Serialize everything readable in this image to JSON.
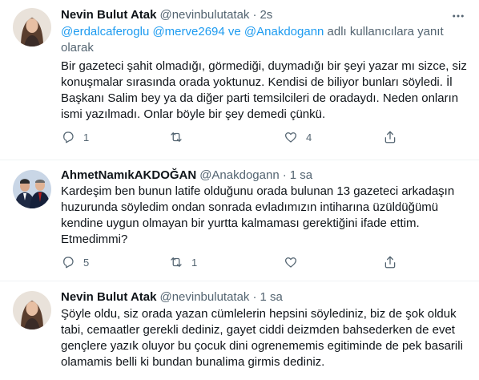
{
  "tweets": [
    {
      "author_name": "Nevin Bulut Atak",
      "handle": "@nevinbulutatak",
      "separator": "·",
      "time": "2s",
      "reply_mentions": "@erdalcaferoglu @merve2694 ve @Anakdogann",
      "reply_suffix": " adlı kullanıcılara yanıt olarak",
      "lines": [
        "Bir gazeteci şahit olmadığı, görmediği, duymadığı bir şeyi yazar mı sizce, siz",
        "konuşmalar sırasında orada yoktunuz. Kendisi de biliyor bunları söyledi. İl",
        "Başkanı Salim bey ya da diğer parti temsilcileri de oradaydı. Neden onların",
        "ismi yazılmadı. Onlar böyle bir şey demedi çünkü."
      ],
      "reply_count": "1",
      "retweet_count": "",
      "like_count": "4"
    },
    {
      "author_name": "AhmetNamıkAKDOĞAN",
      "handle": "@Anakdogann",
      "separator": "·",
      "time": "1 sa",
      "lines": [
        "Kardeşim ben bunun latife olduğunu orada bulunan 13 gazeteci arkadaşın",
        "huzurunda söyledim ondan sonrada evladımızın intiharına üzüldüğümü",
        "kendine uygun olmayan bir yurtta kalmaması gerektiğini ifade ettim.",
        "Etmedimmi?"
      ],
      "reply_count": "5",
      "retweet_count": "1",
      "like_count": ""
    },
    {
      "author_name": "Nevin Bulut Atak",
      "handle": "@nevinbulutatak",
      "separator": "·",
      "time": "1 sa",
      "lines": [
        "Şöyle oldu, siz orada yazan cümlelerin hepsini söylediniz, biz de şok olduk",
        "tabi, cemaatler gerekli dediniz, gayet ciddi deizmden bahsederken de evet",
        "gençlere yazık oluyor bu çocuk dini ogrenememis egitiminde de pek basarili",
        "olamamis belli ki bundan bunalima girmis dediniz."
      ]
    }
  ],
  "icons": {
    "more": "more-horizontal-icon",
    "reply": "reply-icon",
    "retweet": "retweet-icon",
    "like": "heart-icon",
    "share": "share-icon"
  },
  "colors": {
    "text": "#0f1419",
    "secondary": "#536471",
    "link": "#1d9bf0",
    "divider": "#eff3f4"
  }
}
